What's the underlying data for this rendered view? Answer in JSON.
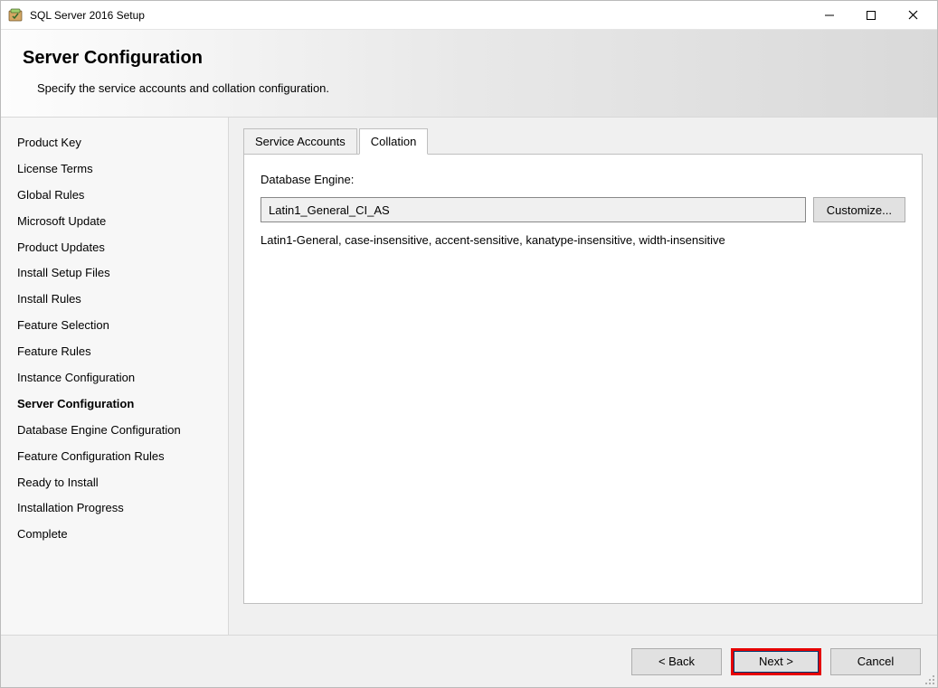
{
  "titlebar": {
    "title": "SQL Server 2016 Setup"
  },
  "header": {
    "title": "Server Configuration",
    "subtitle": "Specify the service accounts and collation configuration."
  },
  "sidebar": {
    "items": [
      "Product Key",
      "License Terms",
      "Global Rules",
      "Microsoft Update",
      "Product Updates",
      "Install Setup Files",
      "Install Rules",
      "Feature Selection",
      "Feature Rules",
      "Instance Configuration",
      "Server Configuration",
      "Database Engine Configuration",
      "Feature Configuration Rules",
      "Ready to Install",
      "Installation Progress",
      "Complete"
    ],
    "active_index": 10
  },
  "tabs": [
    {
      "label": "Service Accounts",
      "active": false
    },
    {
      "label": "Collation",
      "active": true
    }
  ],
  "collation": {
    "label": "Database Engine:",
    "value": "Latin1_General_CI_AS",
    "customize_button": "Customize...",
    "description": "Latin1-General, case-insensitive, accent-sensitive, kanatype-insensitive, width-insensitive"
  },
  "footer": {
    "back": "< Back",
    "next": "Next >",
    "cancel": "Cancel"
  }
}
